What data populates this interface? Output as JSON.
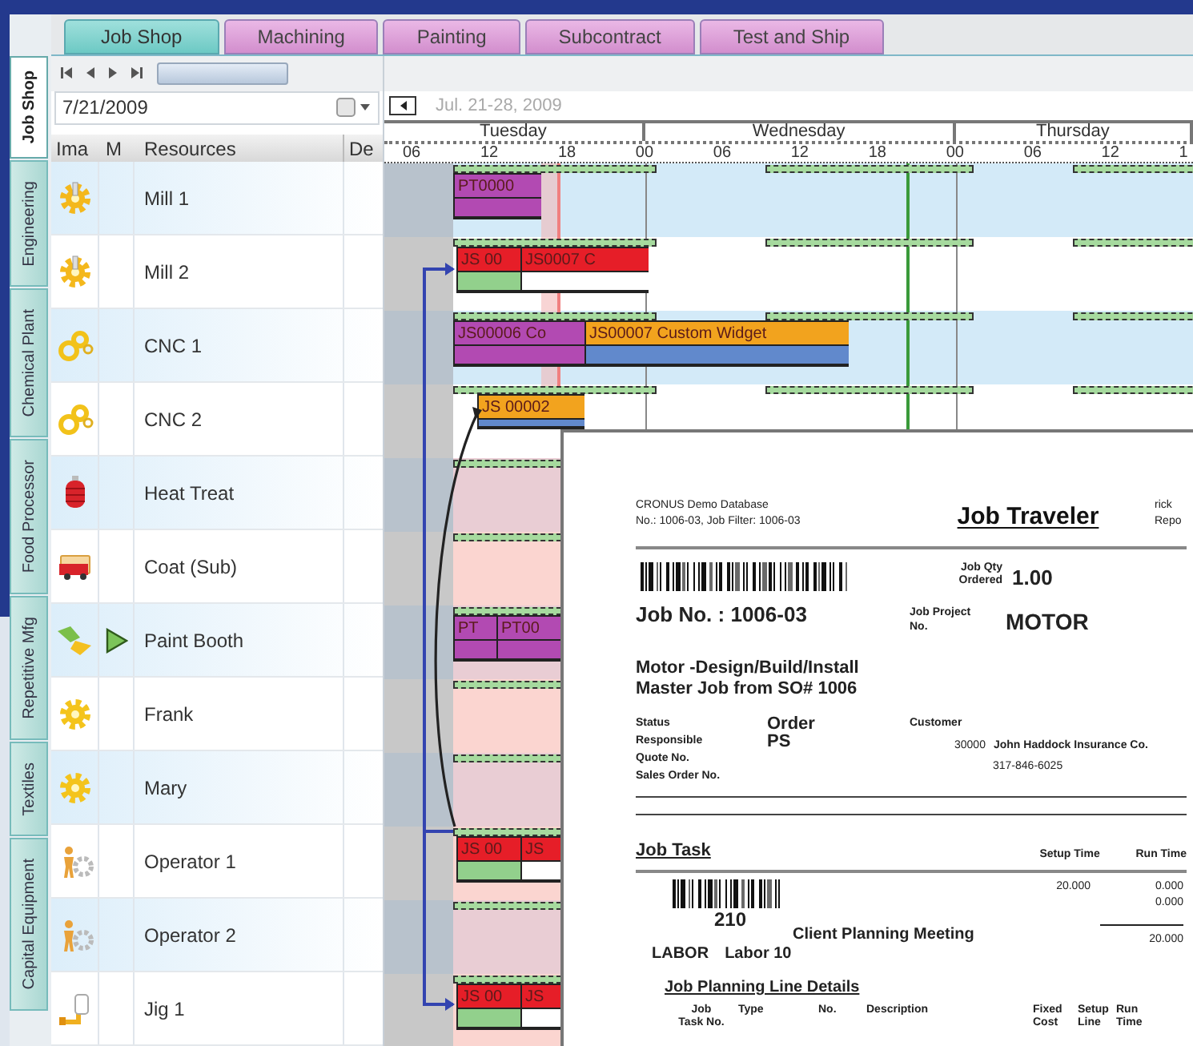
{
  "top_tabs": [
    {
      "label": "Job Shop",
      "selected": true
    },
    {
      "label": "Machining",
      "selected": false
    },
    {
      "label": "Painting",
      "selected": false
    },
    {
      "label": "Subcontract",
      "selected": false
    },
    {
      "label": "Test and Ship",
      "selected": false
    }
  ],
  "side_tabs": [
    {
      "label": "Job Shop",
      "selected": true
    },
    {
      "label": "Engineering",
      "selected": false
    },
    {
      "label": "Chemical Plant",
      "selected": false
    },
    {
      "label": "Food Processor",
      "selected": false
    },
    {
      "label": "Repetitive Mfg",
      "selected": false
    },
    {
      "label": "Textiles",
      "selected": false
    },
    {
      "label": "Capital Equipment",
      "selected": false
    }
  ],
  "date_field": {
    "value": "7/21/2009"
  },
  "timeline": {
    "range": "Jul. 21-28, 2009",
    "days": [
      "Tuesday",
      "Wednesday",
      "Thursday"
    ],
    "hours": [
      "06",
      "12",
      "18",
      "00",
      "06",
      "12",
      "18",
      "00",
      "06",
      "12",
      "1"
    ]
  },
  "columns": [
    "Ima",
    "M",
    "Resources",
    "De"
  ],
  "resources": [
    {
      "name": "Mill 1",
      "kind": "machine",
      "marked": false,
      "tasks": [
        {
          "label": "PT0000",
          "kind": "production",
          "color": "#b24ab2"
        }
      ]
    },
    {
      "name": "Mill 2",
      "kind": "machine",
      "marked": false,
      "tasks": [
        {
          "label": "JS 00",
          "kind": "progress",
          "color": "#e61e28",
          "level": 1
        },
        {
          "label": "JS0007 C",
          "kind": "progress",
          "color": "#e61e28",
          "level": 0
        }
      ]
    },
    {
      "name": "CNC 1",
      "kind": "cnc",
      "marked": false,
      "tasks": [
        {
          "label": "JS00006 Co",
          "kind": "production",
          "color": "#b24ab2"
        },
        {
          "label": "JS00007 Custom Widget",
          "kind": "scheduled",
          "color": "#f2a31e"
        }
      ]
    },
    {
      "name": "CNC 2",
      "kind": "cnc",
      "marked": false,
      "tasks": [
        {
          "label": "JS 00002",
          "kind": "scheduled",
          "color": "#f2a31e"
        }
      ]
    },
    {
      "name": "Heat Treat",
      "kind": "furnace",
      "marked": false
    },
    {
      "name": "Coat (Sub)",
      "kind": "vendor",
      "marked": false
    },
    {
      "name": "Paint Booth",
      "kind": "paint",
      "marked": true,
      "tasks": [
        {
          "label": "PT",
          "kind": "production",
          "color": "#b24ab2"
        },
        {
          "label": "PT00",
          "kind": "production",
          "color": "#b24ab2"
        }
      ]
    },
    {
      "name": "Frank",
      "kind": "labor",
      "marked": false
    },
    {
      "name": "Mary",
      "kind": "labor",
      "marked": false
    },
    {
      "name": "Operator 1",
      "kind": "operator",
      "marked": false,
      "tasks": [
        {
          "label": "JS 00",
          "kind": "progress",
          "color": "#e61e28",
          "level": 1
        },
        {
          "label": "JS",
          "kind": "progress",
          "color": "#e61e28",
          "level": 0
        }
      ]
    },
    {
      "name": "Operator 2",
      "kind": "operator",
      "marked": false
    },
    {
      "name": "Jig 1",
      "kind": "tool",
      "marked": false,
      "tasks": [
        {
          "label": "JS 00",
          "kind": "progress",
          "color": "#e61e28",
          "level": 1
        },
        {
          "label": "JS",
          "kind": "progress",
          "color": "#e61e28",
          "level": 0
        }
      ]
    }
  ],
  "report": {
    "database": "CRONUS Demo Database",
    "filter": "No.: 1006-03, Job Filter: 1006-03",
    "title": "Job Traveler",
    "user": "rick",
    "report_label": "Repo",
    "job_no": "Job No. : 1006-03",
    "qty_label": "Job Qty\nOrdered",
    "qty": "1.00",
    "project_label": "Job Project\nNo.",
    "project": "MOTOR",
    "description": "Motor -Design/Build/Install\nMaster Job from SO# 1006",
    "fields": [
      {
        "label": "Status",
        "value": "Order"
      },
      {
        "label": "Responsible",
        "value": "PS"
      },
      {
        "label": "Quote No."
      },
      {
        "label": "Sales Order No."
      }
    ],
    "customer_label": "Customer",
    "customer_no": "30000",
    "customer_name": "John Haddock Insurance Co.",
    "customer_phone": "317-846-6025",
    "task_section": "Job Task",
    "setup_header": "Setup Time",
    "run_header": "Run Time",
    "task": {
      "no": "210",
      "description": "Client Planning Meeting",
      "setup": "20.000",
      "run": [
        "0.000",
        "0.000"
      ],
      "total": "20.000",
      "resource_type": "LABOR",
      "resource": "Labor 10"
    },
    "details_title": "Job Planning Line Details",
    "detail_columns": [
      "Job\nTask No.",
      "Type",
      "No.",
      "Description",
      "Fixed\nCost",
      "Setup\nLine",
      "Run\nTime"
    ]
  }
}
